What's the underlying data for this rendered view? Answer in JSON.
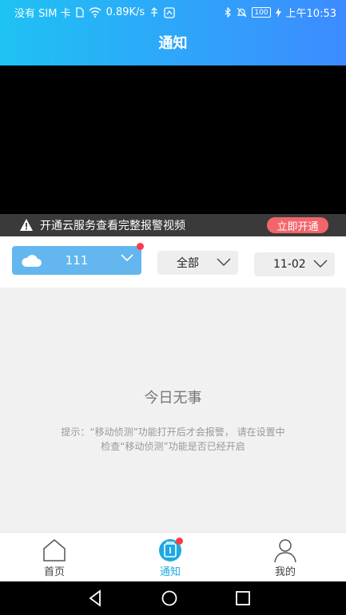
{
  "status_bar": {
    "carrier": "没有 SIM 卡",
    "net_speed": "0.89K/s",
    "battery": "100",
    "time": "上午10:53"
  },
  "header": {
    "title": "通知"
  },
  "banner": {
    "text": "开通云服务查看完整报警视频",
    "button": "立即开通"
  },
  "filters": {
    "device": "111",
    "type": "全部",
    "date": "11-02"
  },
  "content": {
    "empty_title": "今日无事",
    "hint_line1": "提示：“移动侦测”功能打开后才会报警，  请在设置中",
    "hint_line2": "检查“移动侦测”功能是否已经开启"
  },
  "tabs": [
    {
      "label": "首页",
      "icon": "home-icon"
    },
    {
      "label": "通知",
      "icon": "notification-icon",
      "active": true
    },
    {
      "label": "我的",
      "icon": "profile-icon"
    }
  ],
  "colors": {
    "header_start": "#1ec2f3",
    "header_end": "#3d8bff",
    "device_chip": "#63b7ee",
    "banner_button": "#f2666b",
    "badge": "#ff3b47",
    "tab_active": "#1ea9e2"
  }
}
